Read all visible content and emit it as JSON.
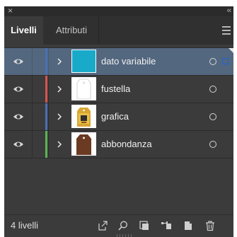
{
  "window": {
    "close_glyph": "×",
    "collapse_glyph": "‹‹"
  },
  "tabs": [
    {
      "label": "Livelli",
      "active": true
    },
    {
      "label": "Attributi",
      "active": false
    }
  ],
  "layers": [
    {
      "name": "dato variabile",
      "color": "#4a6fb5",
      "selected": true,
      "visible": true,
      "thumbnail": "cyan-rectangle"
    },
    {
      "name": "fustella",
      "color": "#d9534f",
      "selected": false,
      "visible": true,
      "thumbnail": "white-tag-outline"
    },
    {
      "name": "grafica",
      "color": "#4a6fb5",
      "selected": false,
      "visible": true,
      "thumbnail": "yellow-tag-artwork"
    },
    {
      "name": "abbondanza",
      "color": "#5ab552",
      "selected": false,
      "visible": true,
      "thumbnail": "brown-tag-shape"
    }
  ],
  "footer": {
    "layer_count": "4 livelli",
    "icons": [
      "export-icon",
      "locate-object-icon",
      "clipping-mask-icon",
      "new-sublayer-icon",
      "new-layer-icon",
      "trash-icon"
    ]
  },
  "colors": {
    "panel_bg": "#3b3b3b",
    "selected_row": "#53677f",
    "selection_square": "#1e63d8"
  }
}
